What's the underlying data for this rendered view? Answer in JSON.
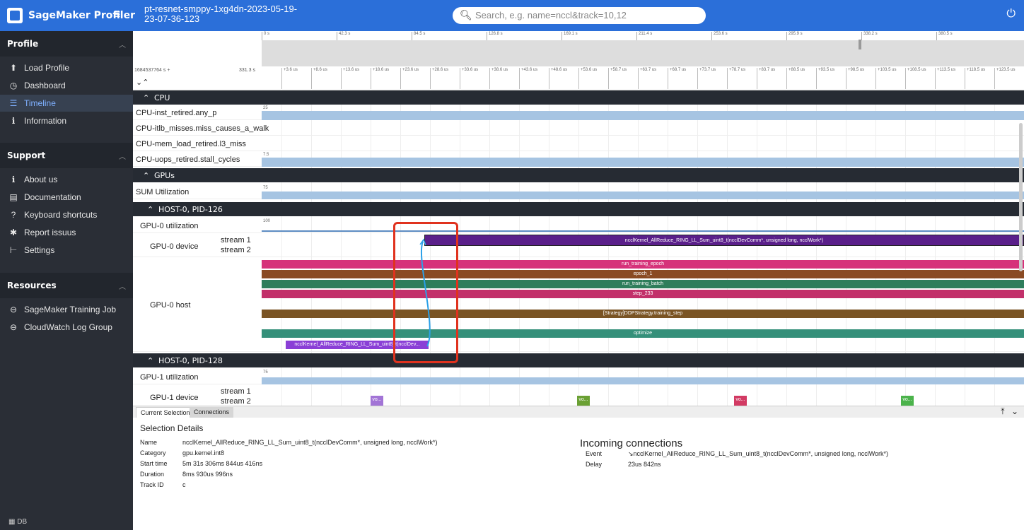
{
  "app": {
    "brand": "SageMaker Profiler",
    "trace_title": "pt-resnet-smppy-1xg4dn-2023-05-19-23-07-36-123",
    "search_placeholder": "Search, e.g. name=nccl&track=10,12"
  },
  "sidebar": {
    "sections": [
      {
        "title": "Profile",
        "items": [
          {
            "label": "Load Profile",
            "icon": "upload-icon"
          },
          {
            "label": "Dashboard",
            "icon": "dashboard-icon"
          },
          {
            "label": "Timeline",
            "icon": "timeline-icon",
            "active": true
          },
          {
            "label": "Information",
            "icon": "info-icon"
          }
        ]
      },
      {
        "title": "Support",
        "items": [
          {
            "label": "About us",
            "icon": "info-icon"
          },
          {
            "label": "Documentation",
            "icon": "document-icon"
          },
          {
            "label": "Keyboard shortcuts",
            "icon": "help-icon"
          },
          {
            "label": "Report issuus",
            "icon": "bug-icon"
          },
          {
            "label": "Settings",
            "icon": "settings-icon"
          }
        ]
      },
      {
        "title": "Resources",
        "items": [
          {
            "label": "SageMaker Training Job",
            "icon": "link-icon"
          },
          {
            "label": "CloudWatch Log Group",
            "icon": "link-icon"
          }
        ]
      }
    ],
    "bottom_badge": "DB"
  },
  "overview": {
    "ticks": [
      "0 s",
      "42.3 s",
      "84.5 s",
      "126.8 s",
      "169.1 s",
      "211.4 s",
      "253.6 s",
      "295.9 s",
      "338.2 s",
      "380.5 s"
    ]
  },
  "ruler": {
    "base": "1684537764 s +",
    "span": "331.3 s",
    "ticks": [
      "+3.6 us",
      "+8.6 us",
      "+13.6 us",
      "+18.6 us",
      "+23.6 us",
      "+28.6 us",
      "+33.6 us",
      "+38.6 us",
      "+43.6 us",
      "+48.6 us",
      "+53.6 us",
      "+58.7 us",
      "+63.7 us",
      "+68.7 us",
      "+73.7 us",
      "+78.7 us",
      "+83.7 us",
      "+88.5 us",
      "+93.5 us",
      "+98.5 us",
      "+103.5 us",
      "+108.5 us",
      "+113.5 us",
      "+118.5 us",
      "+123.5 us"
    ]
  },
  "tracks": {
    "cpu_header": "CPU",
    "cpu_rows": [
      {
        "label": "CPU-inst_retired.any_p",
        "scale": "25"
      },
      {
        "label": "CPU-itlb_misses.miss_causes_a_walk",
        "scale": ""
      },
      {
        "label": "CPU-mem_load_retired.l3_miss",
        "scale": ""
      },
      {
        "label": "CPU-uops_retired.stall_cycles",
        "scale": "7.5"
      }
    ],
    "gpus_header": "GPUs",
    "sum_util": {
      "label": "SUM Utilization",
      "scale": "75"
    },
    "host0_header": "HOST-0, PID-126",
    "gpu0_util": {
      "label": "GPU-0 utilization",
      "scale": "100"
    },
    "gpu0_device": {
      "label": "GPU-0 device",
      "stream1": "stream 1",
      "stream2": "stream 2",
      "kernel": "ncclKernel_AllReduce_RING_LL_Sum_uint8_t(ncclDevComm*, unsigned long, ncclWork*)"
    },
    "gpu0_host": {
      "label": "GPU-0 host",
      "bars": [
        {
          "text": "run_training_epoch",
          "color": "#d6327a"
        },
        {
          "text": "epoch_1",
          "color": "#8a4a23"
        },
        {
          "text": "run_training_batch",
          "color": "#2e7d5b"
        },
        {
          "text": "step_233",
          "color": "#c2306a"
        },
        {
          "text": "[Strategy]DDPStrategy.training_step",
          "color": "#7a5424"
        },
        {
          "text": "optimize",
          "color": "#35907a"
        },
        {
          "text": "ncclKernel_AllReduce_RING_LL_Sum_uint8_t(ncclDev...",
          "color": "#8a3fd6"
        }
      ]
    },
    "host1_header": "HOST-0, PID-128",
    "gpu1_util": {
      "label": "GPU-1 utilization",
      "scale": "75"
    },
    "gpu1_device": {
      "label": "GPU-1 device",
      "stream1": "stream 1",
      "stream2": "stream 2",
      "tags": [
        "vo...",
        "vo...",
        "vo...",
        "vo..."
      ]
    }
  },
  "panel": {
    "tabs": [
      "Current Selection",
      "Connections"
    ],
    "selection_title": "Selection Details",
    "details": [
      {
        "key": "Name",
        "value": "ncclKernel_AllReduce_RING_LL_Sum_uint8_t(ncclDevComm*, unsigned long, ncclWork*)"
      },
      {
        "key": "Category",
        "value": "gpu.kernel.int8"
      },
      {
        "key": "Start time",
        "value": "5m 31s 306ms 844us 416ns"
      },
      {
        "key": "Duration",
        "value": "8ms 930us 996ns"
      },
      {
        "key": "Track ID",
        "value": "c"
      }
    ],
    "incoming_title": "Incoming connections",
    "incoming": [
      {
        "key": "Event",
        "value": "↘ncclKernel_AllReduce_RING_LL_Sum_uint8_t(ncclDevComm*, unsigned long, ncclWork*)"
      },
      {
        "key": "Delay",
        "value": "23us 842ns"
      }
    ]
  }
}
